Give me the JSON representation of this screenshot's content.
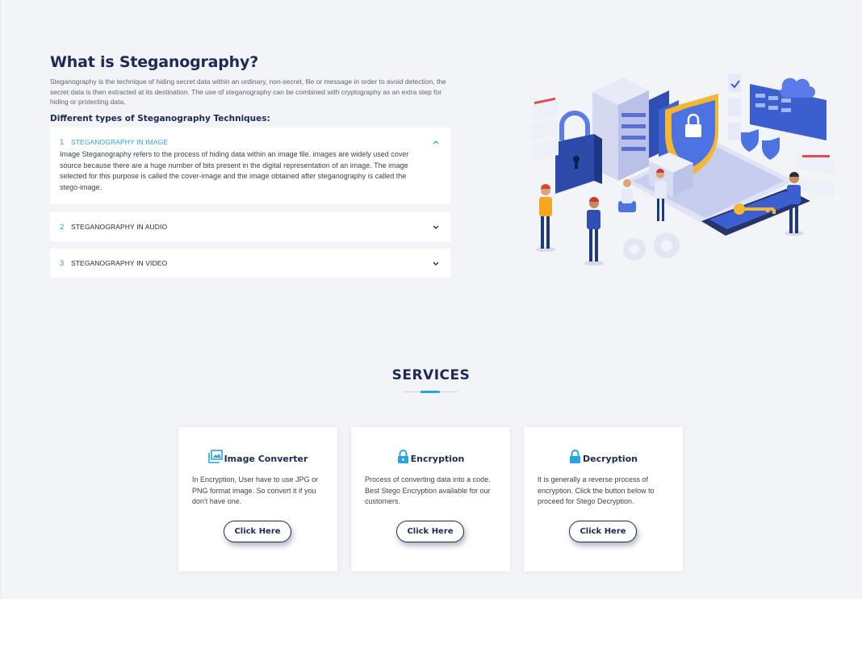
{
  "about": {
    "title": "What is Steganography?",
    "description": "Steganography is the technique of hiding secret data within an ordinary, non-secret, file or message in order to avoid detection, the secret data is then extracted at its destination. The use of steganography can be combined with cryptography as an extra step for hiding or protecting data.",
    "subtitle": "Different types of Steganography Techniques:"
  },
  "accordion": [
    {
      "num": "1",
      "label": "STEGANOGRAPHY IN IMAGE",
      "expanded": true,
      "body": "Image Steganography refers to the process of hiding data within an image file. images are widely used cover source because there are a huge number of bits present in the digital representation of an image. The image selected for this purpose is called the cover-image and the image obtained after steganography is called the stego-image."
    },
    {
      "num": "2",
      "label": "STEGANOGRAPHY IN AUDIO",
      "expanded": false
    },
    {
      "num": "3",
      "label": "STEGANOGRAPHY IN VIDEO",
      "expanded": false
    }
  ],
  "services": {
    "title": "SERVICES",
    "cards": [
      {
        "icon": "image-icon",
        "title": "Image Converter",
        "text": "In Encryption, User have to use JPG or PNG format image. So convert it if you don't have one.",
        "button": "Click Here"
      },
      {
        "icon": "lock-icon",
        "title": "Encryption",
        "text": "Process of converting data into a code. Best Stego Encryption available for our customers.",
        "button": "Click Here"
      },
      {
        "icon": "lock-icon",
        "title": "Decryption",
        "text": "It is generally a reverse process of encryption. Click the button below to proceed for Stego Decryption.",
        "button": "Click Here"
      }
    ]
  },
  "colors": {
    "accent": "#2aa4e0",
    "navy": "#1d2a53",
    "background": "#f3f4f8"
  }
}
